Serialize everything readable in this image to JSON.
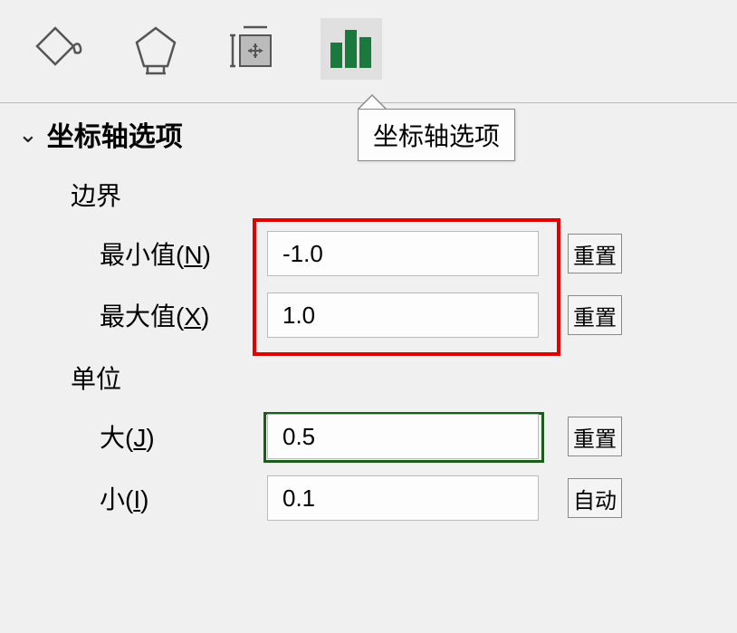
{
  "tooltip": "坐标轴选项",
  "section_title": "坐标轴选项",
  "bounds": {
    "label": "边界",
    "min_label_pre": "最小值(",
    "min_key": "N",
    "min_label_post": ")",
    "min_value": "-1.0",
    "min_reset": "重置",
    "max_label_pre": "最大值(",
    "max_key": "X",
    "max_label_post": ")",
    "max_value": "1.0",
    "max_reset": "重置"
  },
  "units": {
    "label": "单位",
    "major_label_pre": "大(",
    "major_key": "J",
    "major_label_post": ")",
    "major_value": "0.5",
    "major_reset": "重置",
    "minor_label_pre": "小(",
    "minor_key": "I",
    "minor_label_post": ")",
    "minor_value": "0.1",
    "minor_reset": "自动"
  }
}
